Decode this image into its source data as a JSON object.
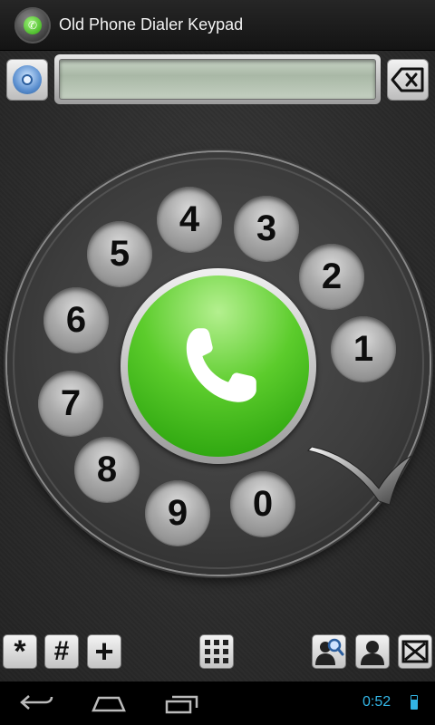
{
  "app": {
    "title": "Old Phone Dialer Keypad"
  },
  "display": {
    "number": ""
  },
  "dial": {
    "digits": [
      "1",
      "2",
      "3",
      "4",
      "5",
      "6",
      "7",
      "8",
      "9",
      "0"
    ]
  },
  "toolbar": {
    "star_label": "*",
    "hash_label": "#",
    "plus_label": "+"
  },
  "status": {
    "time": "0:52"
  },
  "colors": {
    "accent": "#33b5e5",
    "call_green": "#3fbf19",
    "background": "#2e2e2e"
  },
  "icons": {
    "settings": "settings-ring-icon",
    "backspace": "backspace-icon",
    "call": "phone-handset-icon",
    "keypad": "keypad-grid-icon",
    "search_contacts": "contact-search-icon",
    "contacts": "contact-person-icon",
    "exit": "close-box-icon",
    "back": "back-arrow-icon",
    "home": "home-icon",
    "recents": "recent-apps-icon",
    "battery": "battery-icon"
  }
}
